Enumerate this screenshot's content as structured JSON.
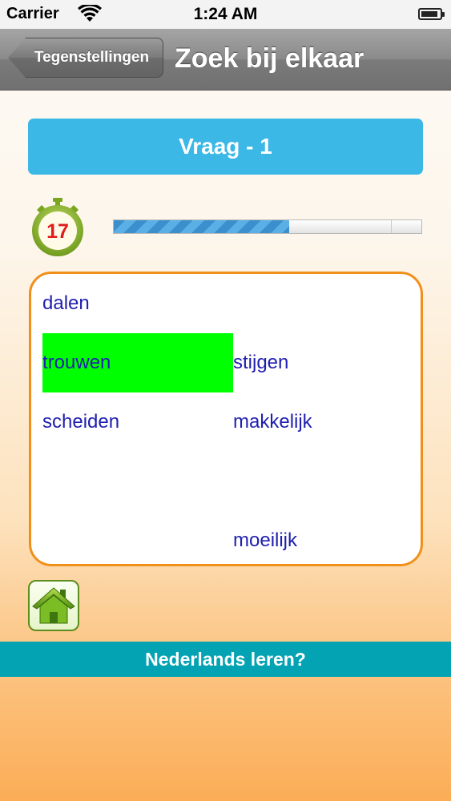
{
  "status_bar": {
    "carrier": "Carrier",
    "time": "1:24 AM",
    "battery_level": 0.9
  },
  "nav": {
    "back_label": "Tegenstellingen",
    "title": "Zoek bij elkaar"
  },
  "question": {
    "label": "Vraag - 1"
  },
  "timer": {
    "seconds": "17",
    "progress": 0.57
  },
  "words": [
    {
      "text": "dalen",
      "column": 1,
      "row": 1,
      "selected": false
    },
    {
      "text": "trouwen",
      "column": 1,
      "row": 2,
      "selected": true
    },
    {
      "text": "stijgen",
      "column": 2,
      "row": 2,
      "selected": false
    },
    {
      "text": "scheiden",
      "column": 1,
      "row": 3,
      "selected": false
    },
    {
      "text": "makkelijk",
      "column": 2,
      "row": 3,
      "selected": false
    },
    {
      "text": "moeilijk",
      "column": 2,
      "row": 5,
      "selected": false
    }
  ],
  "colors": {
    "accent": "#3bb8e6",
    "selected": "#00ff00",
    "word_text": "#1f1fb0",
    "box_border": "#f0901a",
    "banner": "#03a3b3"
  },
  "home": {
    "icon": "home-icon"
  },
  "banner": {
    "label": "Nederlands leren?"
  }
}
